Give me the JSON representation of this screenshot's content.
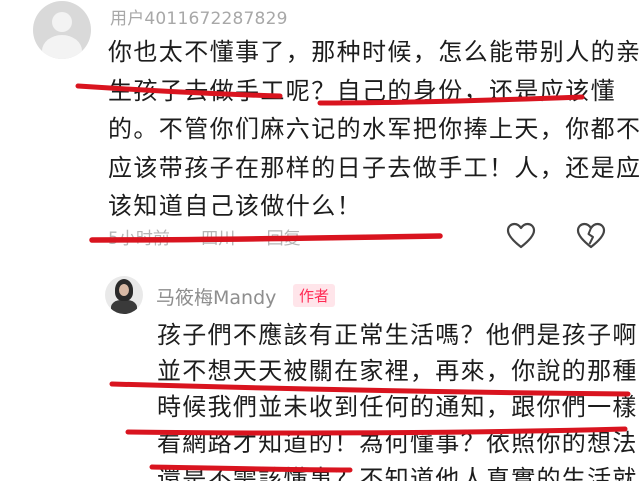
{
  "comment": {
    "username": "用户4011672287829",
    "lines": [
      "你也太不懂事了，那种时候，怎么能带别人的亲",
      "生孩子去做手工呢？自己的身份，还是应该懂",
      "的。不管你们麻六记的水军把你捧上天，你都不",
      "应该带孩子在那样的日子去做手工！人，还是应",
      "该知道自己该做什么！"
    ],
    "meta": {
      "time": "5小时前",
      "location": "四川",
      "reply_label": "回复"
    }
  },
  "reply": {
    "author": "马筱梅Mandy",
    "badge": "作者",
    "lines": [
      "孩子們不應該有正常生活嗎？他們是孩子啊",
      "並不想天天被關在家裡，再來，你說的那種",
      "時候我們並未收到任何的通知，跟你們一樣",
      "看網路才知道的！為何懂事？依照你的想法",
      "還是不需該懂事？不知道他人真實的生活就"
    ]
  },
  "colors": {
    "text": "#1d1d1d",
    "muted": "#a8a8a8",
    "highlight_stroke": "#d9141f",
    "badge_text": "#ff2b55",
    "badge_bg": "#ffe5ea"
  },
  "icons": [
    "avatar-default-icon",
    "heart-outline-icon",
    "broken-heart-icon"
  ]
}
